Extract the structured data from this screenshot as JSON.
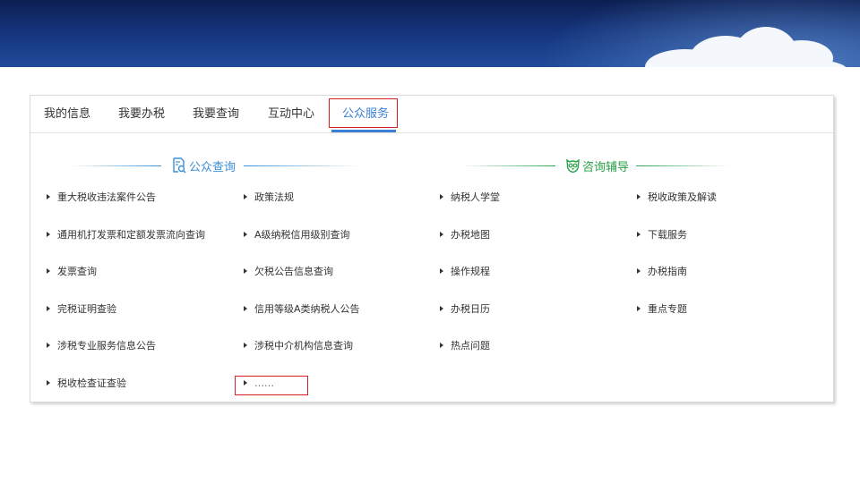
{
  "tabs": [
    {
      "label": "我的信息"
    },
    {
      "label": "我要办税"
    },
    {
      "label": "我要查询"
    },
    {
      "label": "互动中心"
    },
    {
      "label": "公众服务"
    }
  ],
  "sections": {
    "public_query": {
      "title": "公众查询",
      "icon": "document-search-icon",
      "color": "#3a8fd6",
      "col1": [
        "重大税收违法案件公告",
        "通用机打发票和定额发票流向查询",
        "发票查询",
        "完税证明查验",
        "涉税专业服务信息公告",
        "税收检查证查验"
      ],
      "col2": [
        "政策法规",
        "A级纳税信用级别查询",
        "欠税公告信息查询",
        "信用等级A类纳税人公告",
        "涉税中介机构信息查询",
        "……"
      ]
    },
    "consult": {
      "title": "咨询辅导",
      "icon": "owl-icon",
      "color": "#2aa24a",
      "col1": [
        "纳税人学堂",
        "办税地图",
        "操作规程",
        "办税日历",
        "热点问题"
      ],
      "col2": [
        "税收政策及解读",
        "下载服务",
        "办税指南",
        "重点专题"
      ]
    }
  },
  "highlight_color": "#d42020",
  "accent_color": "#3a7fd5"
}
